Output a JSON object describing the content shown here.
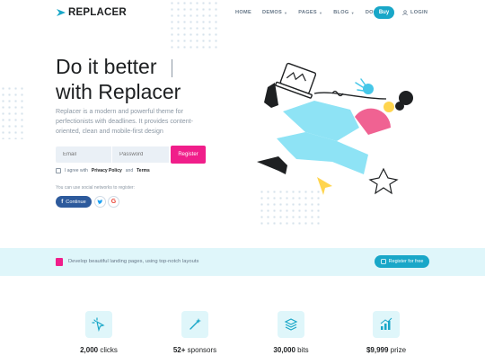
{
  "header": {
    "logo": "REPLACER",
    "nav": [
      {
        "label": "HOME",
        "caret": false
      },
      {
        "label": "DEMOS",
        "caret": true
      },
      {
        "label": "PAGES",
        "caret": true
      },
      {
        "label": "BLOG",
        "caret": true
      },
      {
        "label": "DOCS",
        "caret": true
      }
    ],
    "buy": "Buy",
    "login": "LOGIN"
  },
  "hero": {
    "title_line1": "Do it better",
    "title_line2": "with Replacer",
    "description": "Replacer is a modern and powerful theme for perfectionists with deadlines. It provides content-oriented, clean and mobile-first design",
    "email_placeholder": "Email",
    "password_placeholder": "Password",
    "register": "Register",
    "agree_prefix": "I agree with",
    "privacy": "Privacy Policy",
    "and": "and",
    "terms": "Terms",
    "social_note": "You can use social networks to register:",
    "continue": "Continue",
    "google": "G"
  },
  "banner": {
    "text": "Develop beautiful landing pages, using top-notch layouts",
    "button": "Register for free"
  },
  "stats": [
    {
      "value": "2,000",
      "label": "clicks",
      "icon": "cursor-click-icon"
    },
    {
      "value": "52+",
      "label": "sponsors",
      "icon": "magic-wand-icon"
    },
    {
      "value": "30,000",
      "label": "bits",
      "icon": "layers-icon"
    },
    {
      "value": "$9,999",
      "label": "prize",
      "icon": "growth-chart-icon"
    }
  ],
  "colors": {
    "accent": "#19a7c8",
    "pink": "#f01e8a",
    "facebook": "#2d5a9c",
    "banner_bg": "#dff6fa"
  }
}
